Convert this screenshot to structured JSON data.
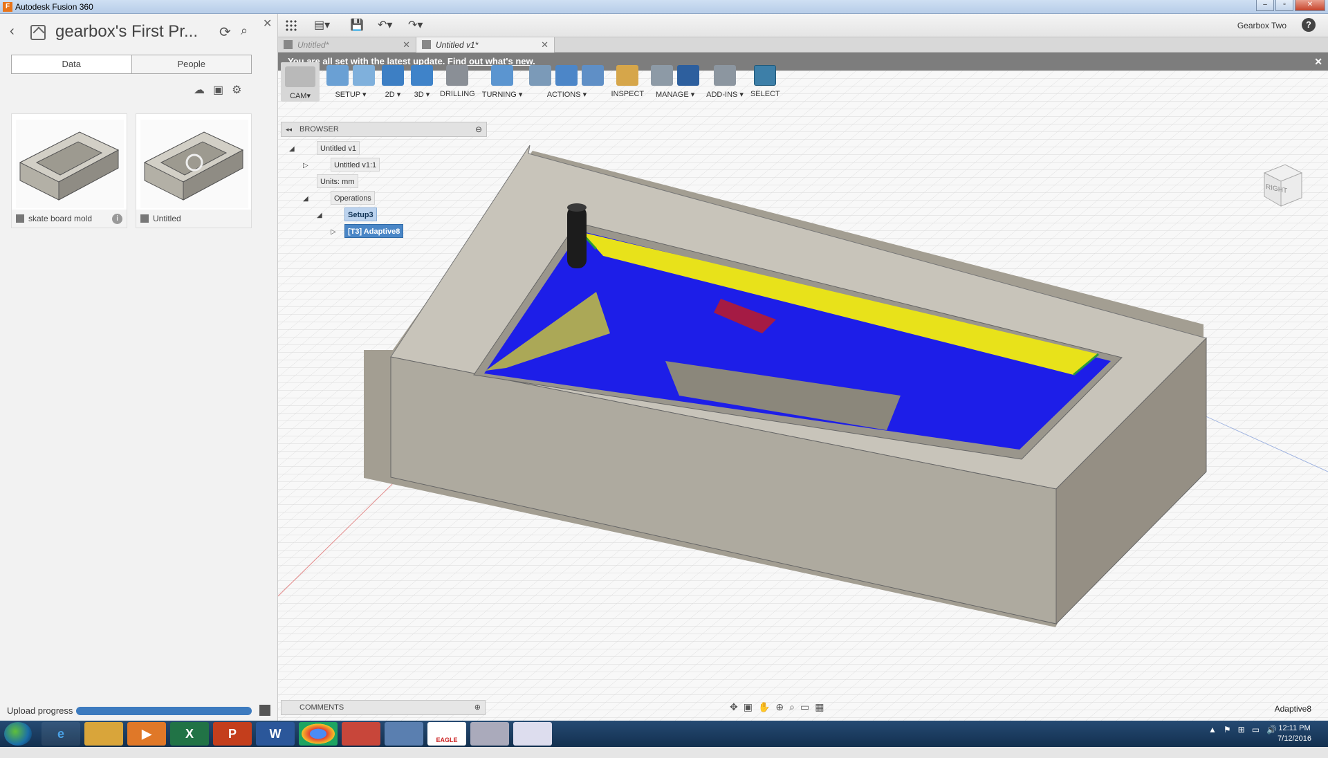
{
  "window": {
    "title": "Autodesk Fusion 360",
    "app_icon": "F"
  },
  "sidebar": {
    "project_title": "gearbox's First Pr...",
    "tabs": [
      "Data",
      "People"
    ],
    "thumbnails": [
      {
        "label": "skate board mold",
        "info": "i"
      },
      {
        "label": "Untitled"
      }
    ],
    "upload_label": "Upload progress",
    "upload_progress": 1.0
  },
  "toolbar": {
    "user": "Gearbox Two",
    "help": "?",
    "doc_tabs": [
      {
        "label": "Untitled*",
        "active": false
      },
      {
        "label": "Untitled v1*",
        "active": true
      }
    ],
    "notice_text": "You are all set with the latest update. ",
    "notice_link": "Find out what's new.",
    "groups": [
      {
        "label": "CAM▾"
      },
      {
        "label": "SETUP ▾"
      },
      {
        "label": "2D ▾"
      },
      {
        "label": "3D ▾"
      },
      {
        "label": "DRILLING"
      },
      {
        "label": "TURNING ▾"
      },
      {
        "label": "ACTIONS ▾"
      },
      {
        "label": "INSPECT"
      },
      {
        "label": "MANAGE ▾"
      },
      {
        "label": "ADD-INS ▾"
      },
      {
        "label": "SELECT"
      }
    ]
  },
  "browser": {
    "title": "BROWSER",
    "items": [
      "Untitled v1",
      "Untitled v1:1",
      "Units: mm",
      "Operations",
      "Setup3",
      "[T3] Adaptive8"
    ]
  },
  "viewcube_label": "RIGHT",
  "comments_label": "COMMENTS",
  "active_operation": "Adaptive8",
  "taskbar": {
    "clock_time": "12:11 PM",
    "clock_date": "7/12/2016",
    "eagle_label": "EAGLE"
  }
}
